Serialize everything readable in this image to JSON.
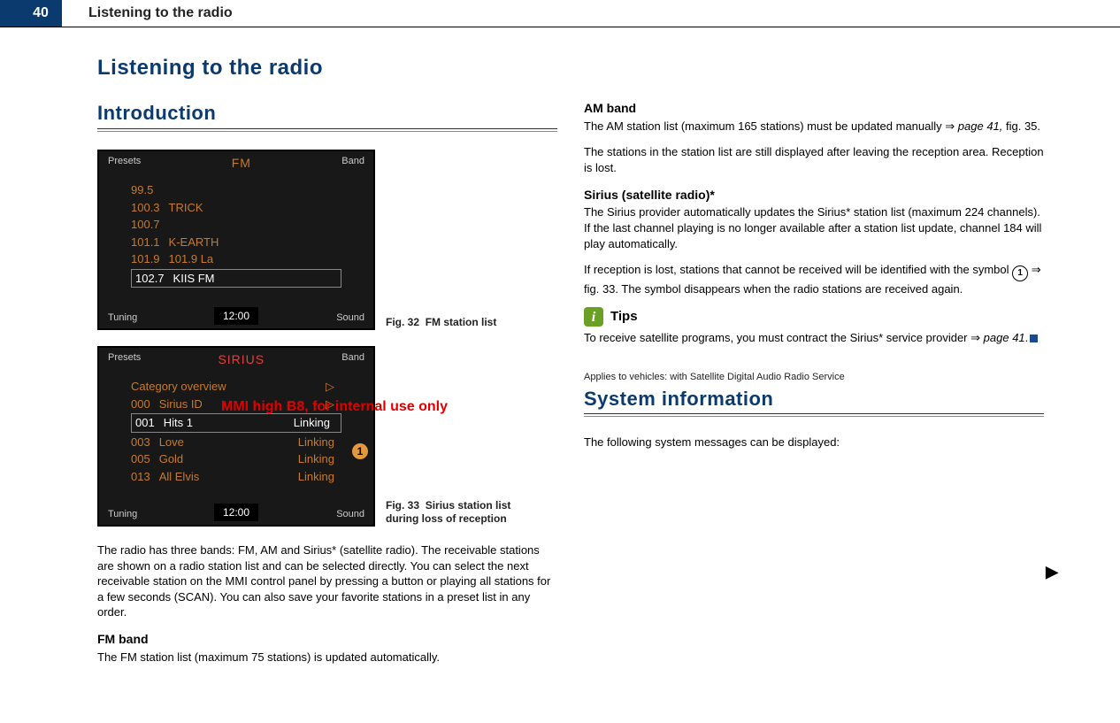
{
  "header": {
    "page_number": "40",
    "title": "Listening to the radio"
  },
  "chapter_title": "Listening to the radio",
  "left": {
    "section_title": "Introduction",
    "fig32": {
      "label": "Fig. 32",
      "caption": "FM station list",
      "top_left": "Presets",
      "top_center": "FM",
      "top_right": "Band",
      "stations": [
        {
          "freq": "99.5",
          "name": ""
        },
        {
          "freq": "100.3",
          "name": "TRICK"
        },
        {
          "freq": "100.7",
          "name": ""
        },
        {
          "freq": "101.1",
          "name": "K-EARTH"
        },
        {
          "freq": "101.9",
          "name": "101.9 La"
        }
      ],
      "selected": {
        "freq": "102.7",
        "name": "KIIS FM"
      },
      "bottom_left": "Tuning",
      "bottom_right": "Sound",
      "clock": "12:00"
    },
    "fig33": {
      "label": "Fig. 33",
      "caption": "Sirius station list during loss of reception",
      "top_left": "Presets",
      "top_center": "SIRIUS",
      "top_right": "Band",
      "rows": [
        {
          "num": "",
          "name": "Category overview",
          "status": ""
        },
        {
          "num": "000",
          "name": "Sirius ID",
          "status": ""
        },
        {
          "num": "001",
          "name": "Hits 1",
          "status": "Linking",
          "selected": true
        },
        {
          "num": "003",
          "name": "Love",
          "status": "Linking"
        },
        {
          "num": "005",
          "name": "Gold",
          "status": "Linking"
        },
        {
          "num": "013",
          "name": "All Elvis",
          "status": "Linking"
        }
      ],
      "marker": "1",
      "bottom_left": "Tuning",
      "bottom_right": "Sound",
      "clock": "12:00"
    },
    "intro_para": "The radio has three bands: FM, AM and Sirius* (satellite radio). The receivable stations are shown on a radio station list and can be selected directly. You can select the next receivable station on the MMI control panel by pressing a button or playing all stations for a few seconds (SCAN). You can also save your favorite stations in a preset list in any order.",
    "fm_head": "FM band",
    "fm_para": "The FM station list (maximum 75 stations) is updated automatically."
  },
  "right": {
    "am_head": "AM band",
    "am_para_a": "The AM station list (maximum 165 stations) must be updated manually ",
    "am_ref": "page 41,",
    "am_para_b": " fig. 35.",
    "am_para2": "The stations in the station list are still displayed after leaving the reception area. Reception is lost.",
    "sirius_head": "Sirius (satellite radio)*",
    "sirius_para1": "The Sirius provider automatically updates the Sirius* station list (maximum 224 channels). If the last channel playing is no longer available after a station list update, channel 184 will play automatically.",
    "sirius_para2_a": "If reception is lost, stations that cannot be received will be identified with the symbol ",
    "sirius_marker": "1",
    "sirius_para2_b": " fig. 33. The symbol disappears when the radio stations are received again.",
    "tips_label": "Tips",
    "tips_para_a": "To receive satellite programs, you must contract the Sirius* service provider ",
    "tips_ref": "page 41",
    "tips_para_b": ".",
    "applies": "Applies to vehicles: with Satellite Digital Audio Radio Service",
    "sysinfo_title": "System information",
    "sysinfo_para": "The following system messages can be displayed:"
  },
  "watermark": "MMI high B8, for internal use only"
}
